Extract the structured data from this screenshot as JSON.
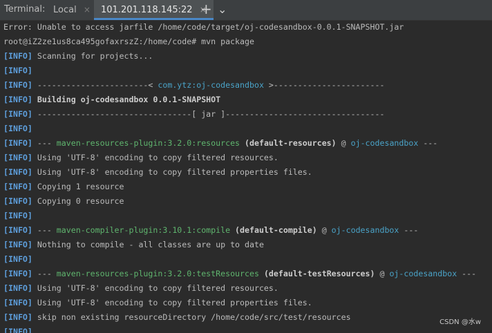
{
  "tabbar": {
    "title": "Terminal:",
    "tabs": [
      {
        "label": "Local",
        "close": "×"
      },
      {
        "label": "101.201.118.145:22",
        "close": "×"
      }
    ],
    "add_label": "+",
    "menu_label": "⌄"
  },
  "terminal": {
    "l1": "Error: Unable to access jarfile /home/code/target/oj-codesandbox-0.0.1-SNAPSHOT.jar",
    "l2": "root@iZ2ze1us8ca495gofaxrszZ:/home/code# mvn package",
    "info_tag": "[INFO]",
    "l3": " Scanning for projects...",
    "l5_a": " -----------------------< ",
    "l5_b": "com.ytz:oj-codesandbox",
    "l5_c": " >-----------------------",
    "l6": " Building oj-codesandbox 0.0.1-SNAPSHOT",
    "l7": " --------------------------------[ jar ]---------------------------------",
    "l9_a": " --- ",
    "l9_b": "maven-resources-plugin:3.2.0:resources",
    "l9_c": " (default-resources)",
    "l9_d": " @ ",
    "l9_e": "oj-codesandbox",
    "l9_f": " ---",
    "l10": " Using 'UTF-8' encoding to copy filtered resources.",
    "l11": " Using 'UTF-8' encoding to copy filtered properties files.",
    "l12": " Copying 1 resource",
    "l13": " Copying 0 resource",
    "l15_a": " --- ",
    "l15_b": "maven-compiler-plugin:3.10.1:compile",
    "l15_c": " (default-compile)",
    "l15_d": " @ ",
    "l15_e": "oj-codesandbox",
    "l15_f": " ---",
    "l16": " Nothing to compile - all classes are up to date",
    "l18_a": " --- ",
    "l18_b": "maven-resources-plugin:3.2.0:testResources",
    "l18_c": " (default-testResources)",
    "l18_d": " @ ",
    "l18_e": "oj-codesandbox",
    "l18_f": " ---",
    "l19": " Using 'UTF-8' encoding to copy filtered resources.",
    "l20": " Using 'UTF-8' encoding to copy filtered properties files.",
    "l21": " skip non existing resourceDirectory /home/code/src/test/resources"
  },
  "watermark": "CSDN @水w"
}
